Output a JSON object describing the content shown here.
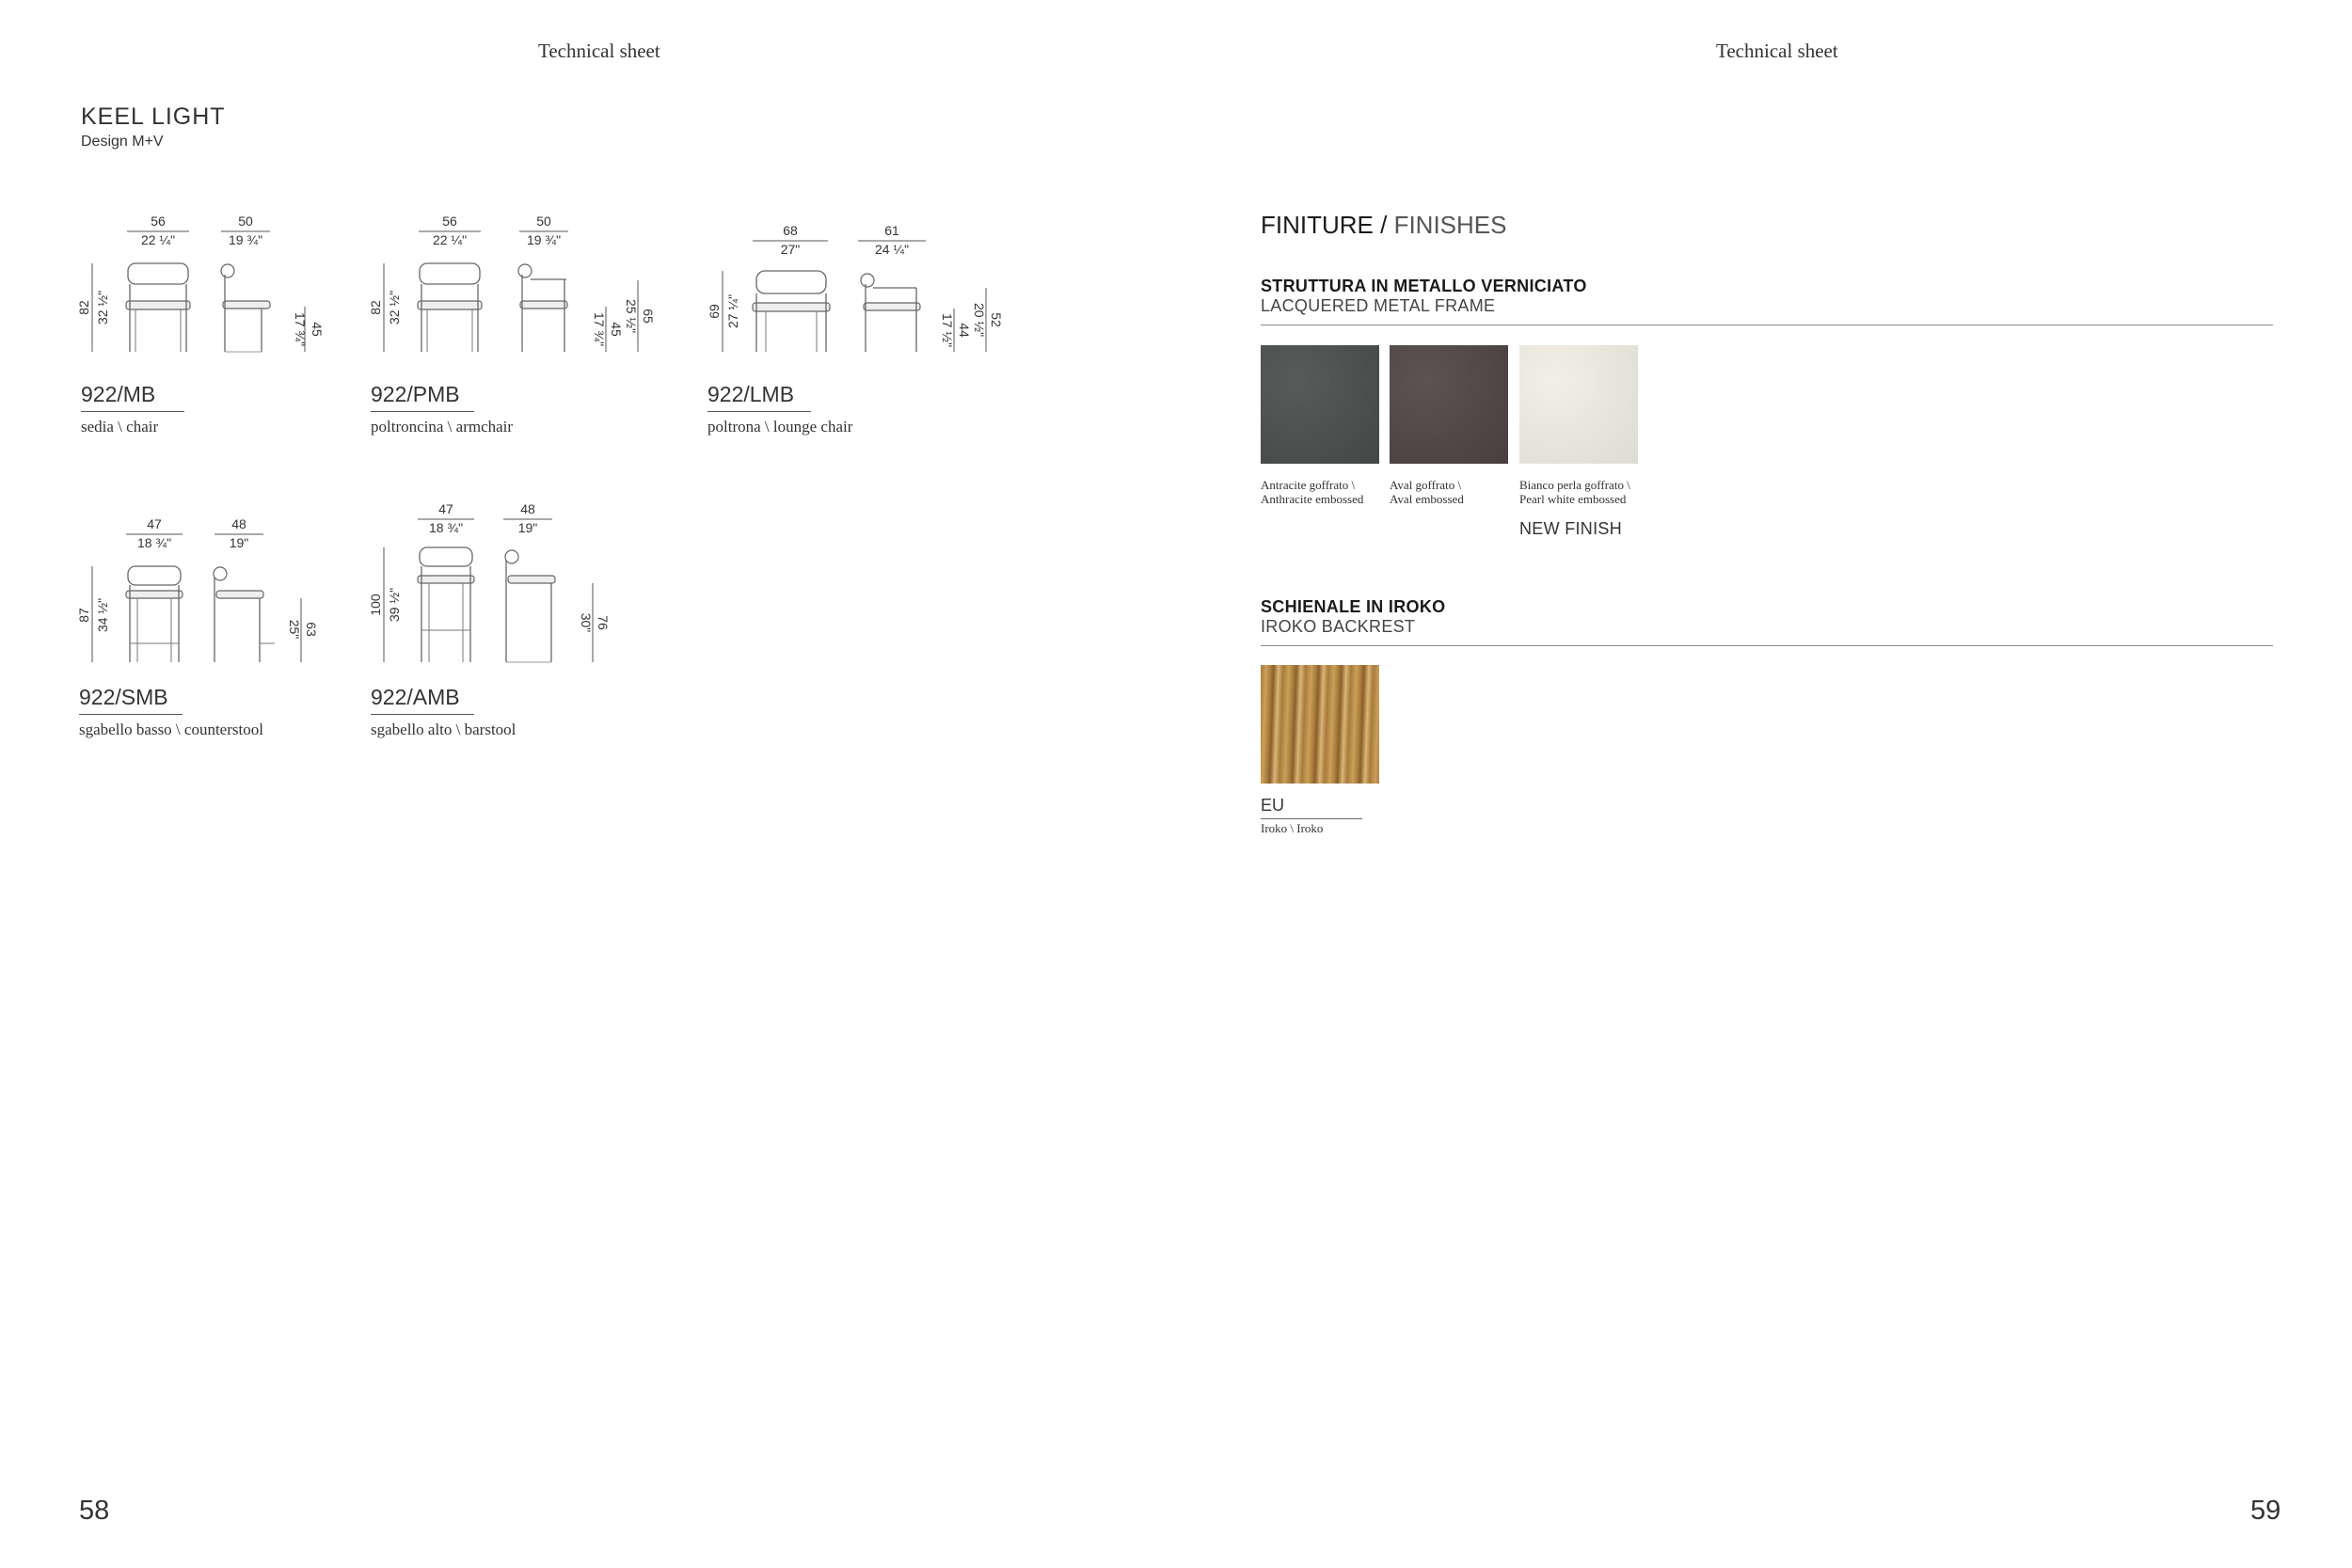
{
  "left_page": {
    "header": "Technical sheet",
    "title": "KEEL LIGHT",
    "designer": "Design M+V",
    "page_number": "58",
    "products": [
      {
        "code": "922/MB",
        "description": "sedia \\ chair",
        "width_cm": "56",
        "width_in": "22 ¼\"",
        "depth_cm": "50",
        "depth_in": "19 ¾\"",
        "height_cm": "82",
        "height_in": "32 ½\"",
        "seat_cm": "45",
        "seat_in": "17 ¾\""
      },
      {
        "code": "922/PMB",
        "description": "poltroncina \\ armchair",
        "width_cm": "56",
        "width_in": "22 ¼\"",
        "depth_cm": "50",
        "depth_in": "19 ¾\"",
        "height_cm": "82",
        "height_in": "32 ½\"",
        "seat_cm": "45",
        "seat_in": "17 ¾\"",
        "arm_cm": "65",
        "arm_in": "25 ½\""
      },
      {
        "code": "922/LMB",
        "description": "poltrona \\ lounge chair",
        "width_cm": "68",
        "width_in": "27\"",
        "depth_cm": "61",
        "depth_in": "24 ¼\"",
        "height_cm": "69",
        "height_in": "27 ¼\"",
        "seat_cm": "44",
        "seat_in": "17 ½\"",
        "arm_cm": "52",
        "arm_in": "20 ½\""
      },
      {
        "code": "922/SMB",
        "description": "sgabello basso \\ counterstool",
        "width_cm": "47",
        "width_in": "18 ¾\"",
        "depth_cm": "48",
        "depth_in": "19\"",
        "height_cm": "87",
        "height_in": "34 ½\"",
        "seat_cm": "63",
        "seat_in": "25\""
      },
      {
        "code": "922/AMB",
        "description": "sgabello alto \\ barstool",
        "width_cm": "47",
        "width_in": "18 ¾\"",
        "depth_cm": "48",
        "depth_in": "19\"",
        "height_cm": "100",
        "height_in": "39 ½\"",
        "seat_cm": "76",
        "seat_in": "30\""
      }
    ]
  },
  "right_page": {
    "header": "Technical sheet",
    "page_number": "59",
    "title_it": "FINITURE",
    "title_sep": " / ",
    "title_en": "FINISHES",
    "frame_section": {
      "title_it": "STRUTTURA IN METALLO VERNICIATO",
      "title_en": "LACQUERED METAL FRAME",
      "swatches": [
        {
          "line1": "Antracite goffrato \\",
          "line2": "Anthracite embossed",
          "color": "#4a4d4c"
        },
        {
          "line1": "Aval goffrato \\",
          "line2": "Aval embossed",
          "color": "#4f4444"
        },
        {
          "line1": "Bianco perla goffrato \\",
          "line2": "Pearl white embossed",
          "color": "#f1eee2"
        }
      ],
      "new_finish": "NEW FINISH"
    },
    "backrest_section": {
      "title_it": "SCHIENALE IN IROKO",
      "title_en": "IROKO BACKREST",
      "swatch_code": "EU",
      "swatch_desc": "Iroko \\ Iroko",
      "wood_colors": [
        "#a87b3c",
        "#c9a059",
        "#8a5f2a",
        "#d9b677"
      ]
    }
  }
}
